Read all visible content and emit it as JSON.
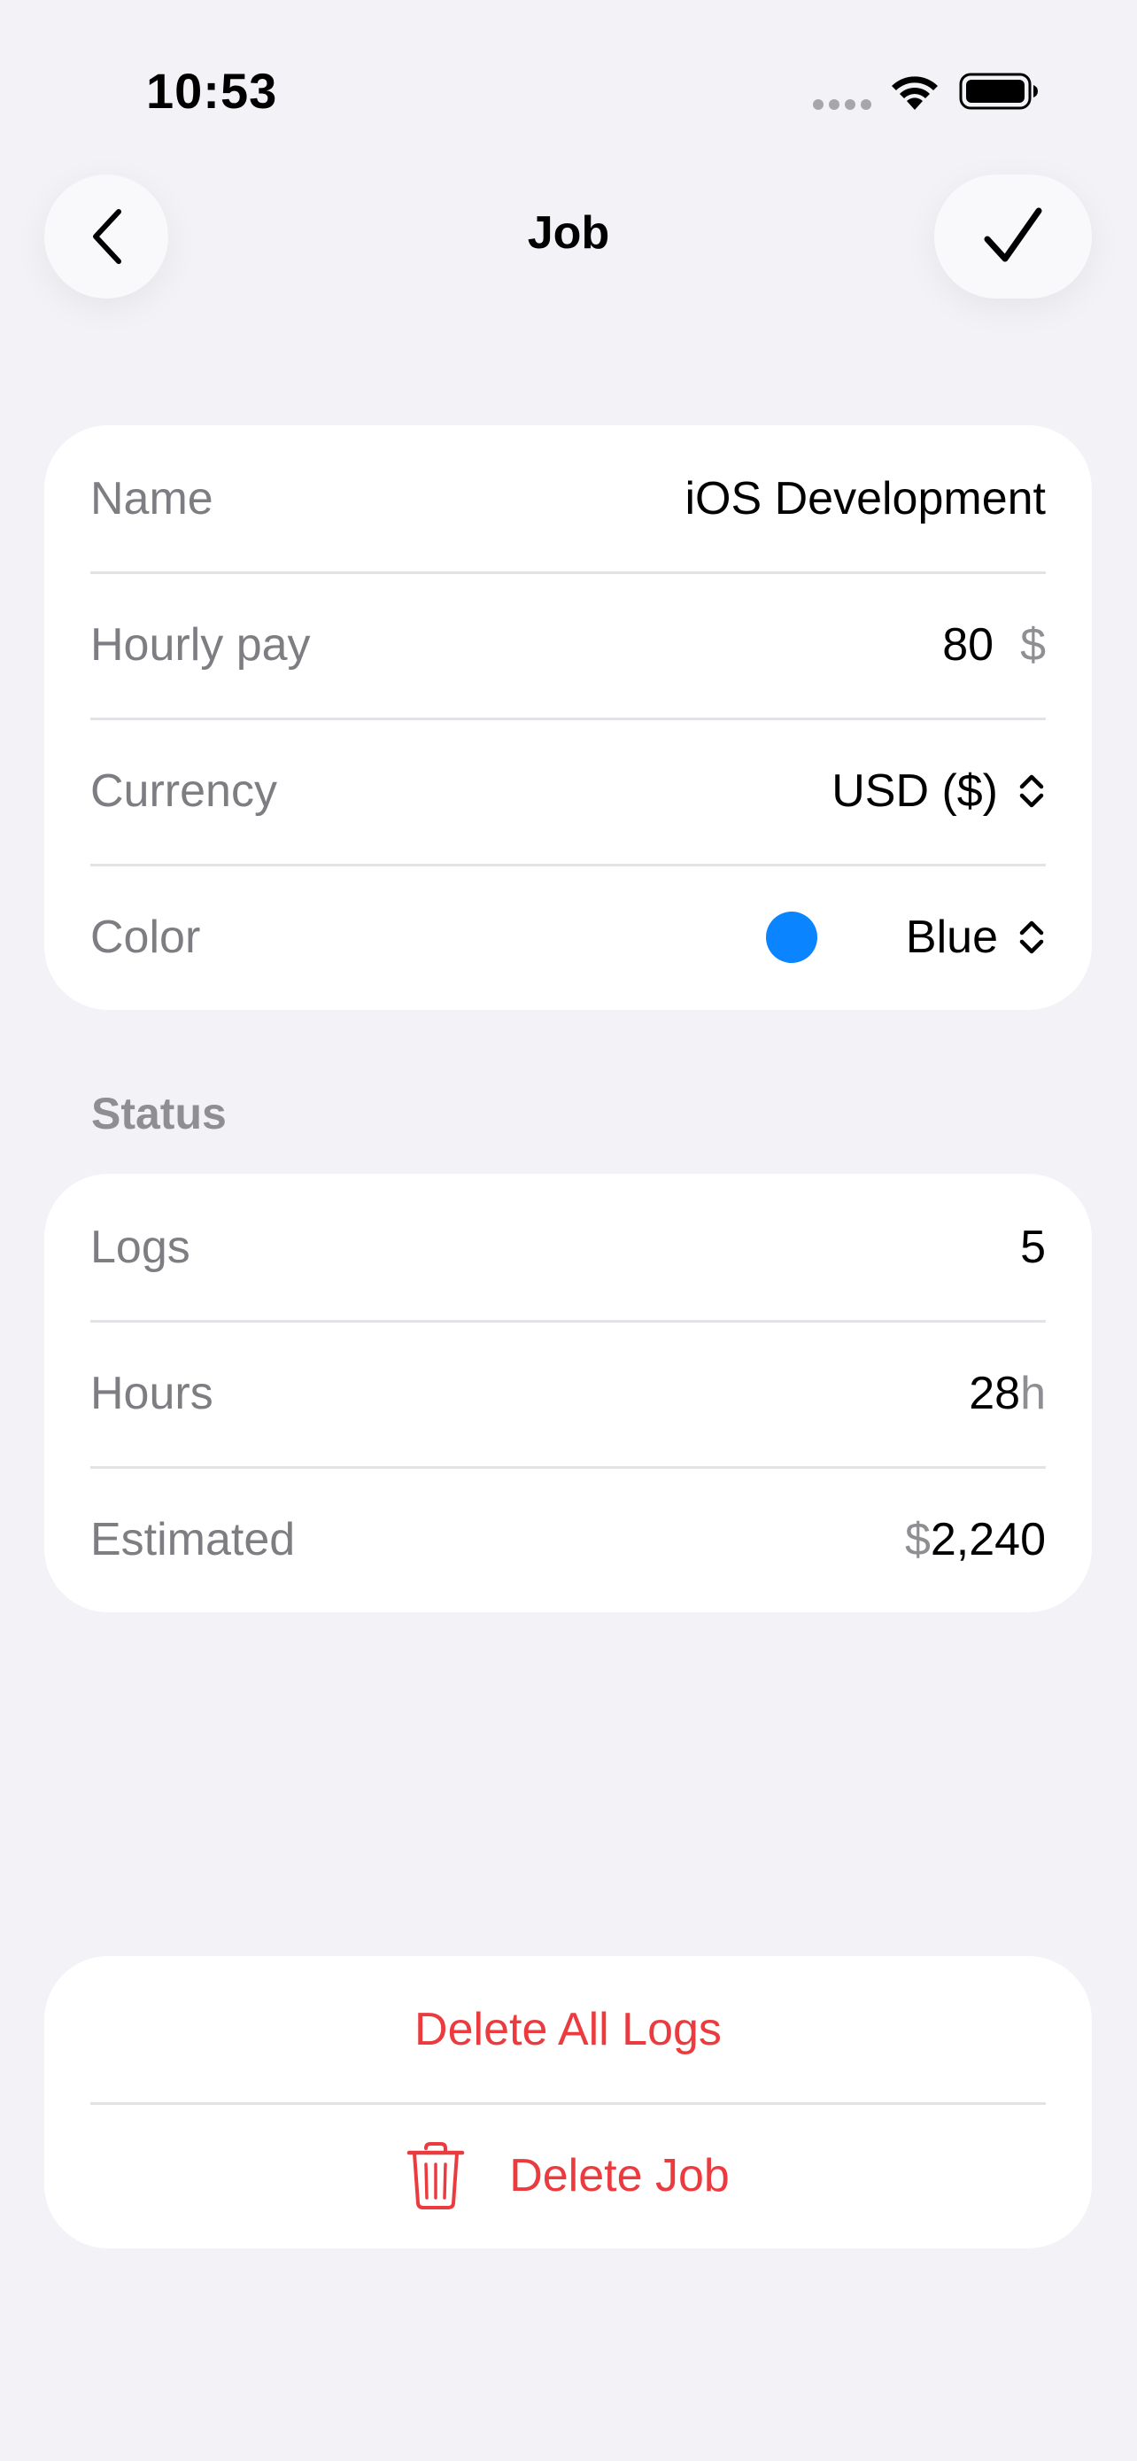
{
  "status_bar": {
    "time": "10:53"
  },
  "nav": {
    "title": "Job"
  },
  "job_form": {
    "name": {
      "label": "Name",
      "value": "iOS Development"
    },
    "hourly_pay": {
      "label": "Hourly pay",
      "value": "80",
      "unit": "$"
    },
    "currency": {
      "label": "Currency",
      "value": "USD ($)"
    },
    "color": {
      "label": "Color",
      "value": "Blue",
      "swatch": "#0a84ff"
    }
  },
  "status_section": {
    "header": "Status",
    "logs": {
      "label": "Logs",
      "value": "5"
    },
    "hours": {
      "label": "Hours",
      "value": "28",
      "unit": "h"
    },
    "estimated": {
      "label": "Estimated",
      "currency_symbol": "$",
      "value": "2,240"
    }
  },
  "danger_zone": {
    "delete_all_logs": "Delete All Logs",
    "delete_job": "Delete Job"
  },
  "colors": {
    "background": "#f2f2f7",
    "destructive": "#eb3b3e",
    "accent_blue": "#0a84ff"
  }
}
